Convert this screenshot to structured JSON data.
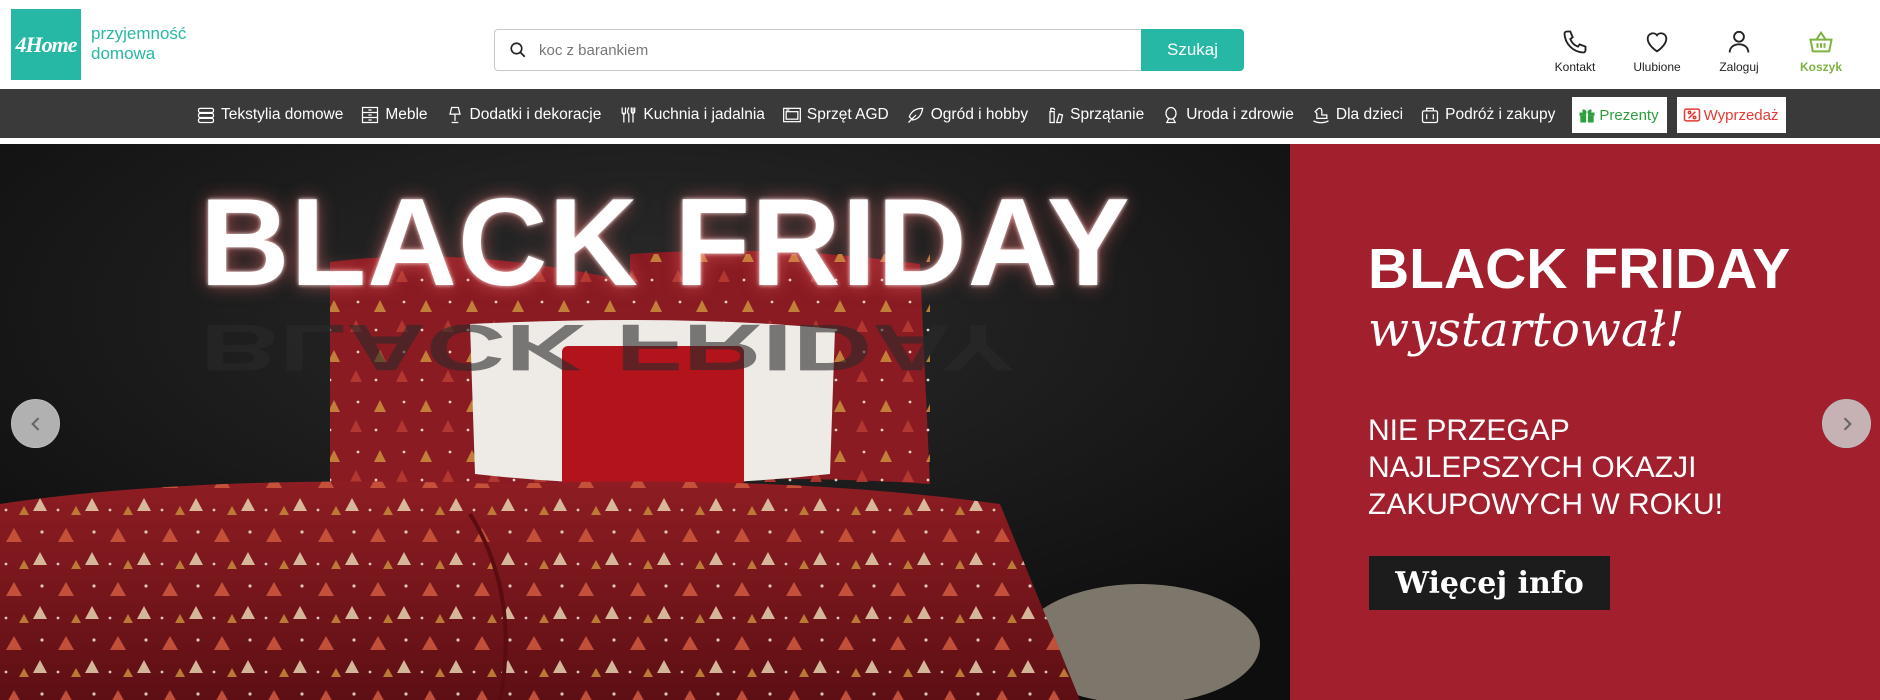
{
  "brand": {
    "logo_text": "4Home",
    "tagline_line1": "przyjemność",
    "tagline_line2": "domowa",
    "accent_color": "#27b8a5"
  },
  "search": {
    "placeholder": "koc z barankiem",
    "button_label": "Szukaj"
  },
  "header_icons": [
    {
      "label": "Kontakt",
      "icon": "phone-icon"
    },
    {
      "label": "Ulubione",
      "icon": "heart-icon"
    },
    {
      "label": "Zaloguj",
      "icon": "user-icon"
    },
    {
      "label": "Koszyk",
      "icon": "basket-icon",
      "color": "#7cb342"
    }
  ],
  "nav": {
    "items": [
      {
        "label": "Tekstylia domowe",
        "icon": "textiles-icon"
      },
      {
        "label": "Meble",
        "icon": "furniture-icon"
      },
      {
        "label": "Dodatki i dekoracje",
        "icon": "lamp-icon"
      },
      {
        "label": "Kuchnia i jadalnia",
        "icon": "cutlery-icon"
      },
      {
        "label": "Sprzęt AGD",
        "icon": "appliance-icon"
      },
      {
        "label": "Ogród i hobby",
        "icon": "garden-icon"
      },
      {
        "label": "Sprzątanie",
        "icon": "cleaning-icon"
      },
      {
        "label": "Uroda i zdrowie",
        "icon": "beauty-icon"
      },
      {
        "label": "Dla dzieci",
        "icon": "rocking-horse-icon"
      },
      {
        "label": "Podróż i zakupy",
        "icon": "suitcase-icon"
      }
    ],
    "gifts_label": "Prezenty",
    "gifts_color": "#2e9e3e",
    "sale_label": "Wyprzedaż",
    "sale_color": "#e53935",
    "background": "#3a3a3a"
  },
  "hero": {
    "photo_headline": "BLACK FRIDAY",
    "panel_title": "BLACK FRIDAY",
    "panel_script": "wystartował!",
    "panel_sub_line1": "NIE PRZEGAP",
    "panel_sub_line2": "NAJLEPSZYCH OKAZJI",
    "panel_sub_line3": "ZAKUPOWYCH W ROKU!",
    "cta_label": "Więcej info",
    "panel_color": "#a21f2e"
  }
}
